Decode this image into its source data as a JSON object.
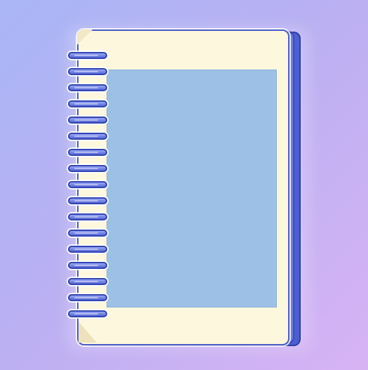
{
  "illustration": {
    "subject": "",
    "colors": {
      "background_start": "#a9b6f6",
      "background_end": "#d8b3f4",
      "page": "#fdf8dd",
      "cover": "#4c5fd0",
      "ring": "#5868d3",
      "photo_area": "#9dc0e6"
    },
    "ring_count": 17
  }
}
